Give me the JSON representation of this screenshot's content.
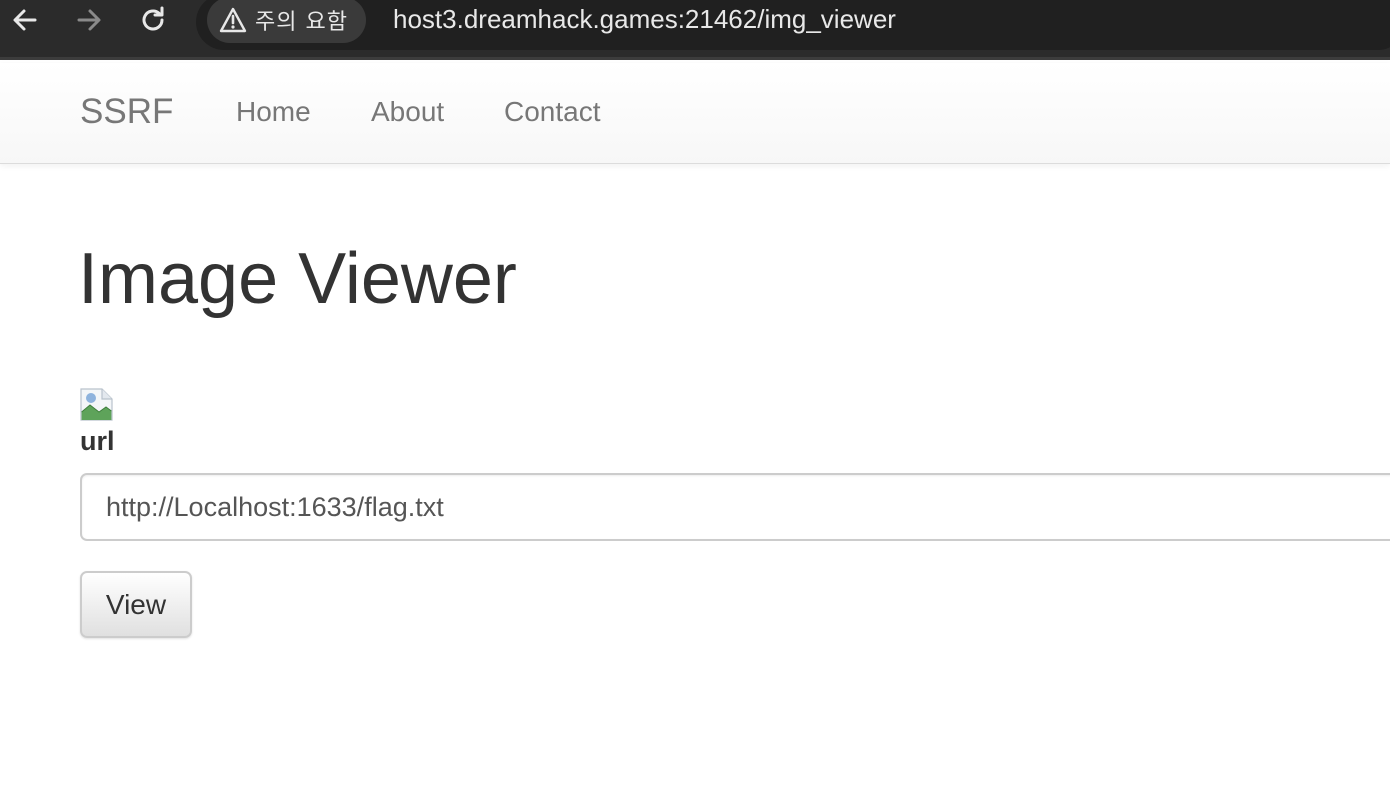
{
  "browser": {
    "url": "host3.dreamhack.games:21462/img_viewer",
    "security_chip": "주의 요함",
    "icons": {
      "back": "arrow-left-icon",
      "forward": "arrow-right-icon",
      "reload": "reload-icon",
      "security": "warning-triangle-icon"
    },
    "colors": {
      "chrome_bg": "#2b2b2b",
      "chrome_text": "#e8e8e8",
      "forward_disabled": "#8a8a8a"
    }
  },
  "navbar": {
    "brand": "SSRF",
    "links": [
      {
        "label": "Home"
      },
      {
        "label": "About"
      },
      {
        "label": "Contact"
      }
    ],
    "colors": {
      "link_text": "#777777"
    }
  },
  "main": {
    "title": "Image Viewer",
    "image_icon": "broken-image-icon",
    "form": {
      "label": "url",
      "input_value": "http://Localhost:1633/flag.txt",
      "submit_label": "View"
    },
    "colors": {
      "text": "#333333",
      "input_border": "#cccccc"
    }
  }
}
